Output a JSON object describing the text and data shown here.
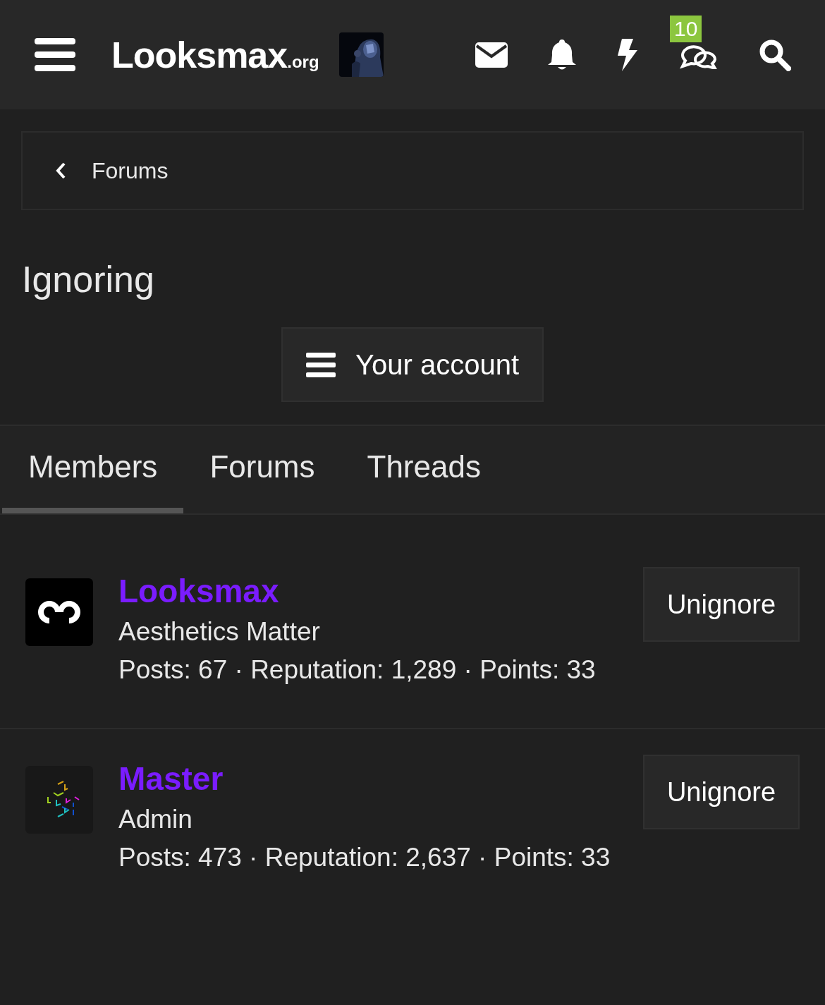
{
  "header": {
    "logo": {
      "name": "Looksmax",
      "suffix": ".org"
    },
    "chat_badge": "10"
  },
  "breadcrumb": {
    "label": "Forums"
  },
  "title": "Ignoring",
  "account_button": "Your account",
  "tabs": [
    {
      "label": "Members",
      "selected": true
    },
    {
      "label": "Forums",
      "selected": false
    },
    {
      "label": "Threads",
      "selected": false
    }
  ],
  "members": [
    {
      "name": "Looksmax",
      "kind": "logo",
      "tagline": "Aesthetics Matter",
      "stats": "Posts: 67 · Reputation: 1,289 · Points: 33",
      "action": "Unignore"
    },
    {
      "name": "Master",
      "kind": "pattern",
      "tagline": "Admin",
      "stats": "Posts: 473 · Reputation: 2,637 · Points: 33",
      "action": "Unignore"
    }
  ]
}
